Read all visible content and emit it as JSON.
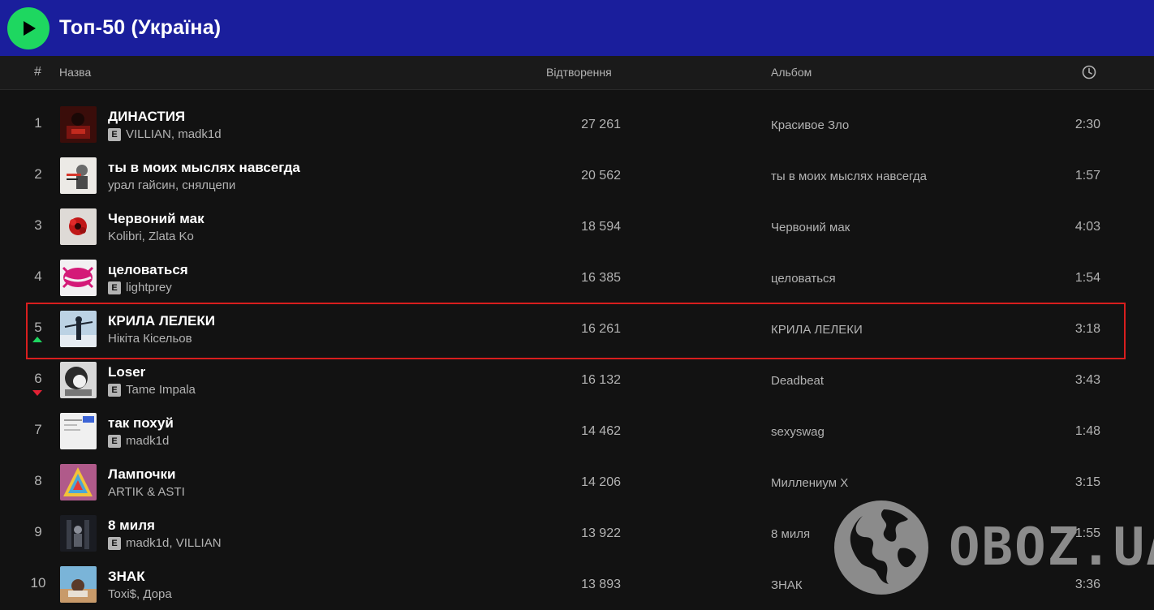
{
  "playlist": {
    "title": "Топ-50 (Україна)",
    "play_icon": "play-icon",
    "accent_color": "#1ed760",
    "header_color": "#1a1e9c"
  },
  "columns": {
    "number": "#",
    "title": "Назва",
    "plays": "Відтворення",
    "album": "Альбом",
    "duration_icon": "clock-icon"
  },
  "tracks": [
    {
      "rank": "1",
      "name": "ДИНАСТИЯ",
      "explicit": true,
      "artists": "VILLIAN, madk1d",
      "plays": "27 261",
      "album": "Красивое Зло",
      "duration": "2:30",
      "trend": ""
    },
    {
      "rank": "2",
      "name": "ты в моих мыслях навсегда",
      "explicit": false,
      "artists": "урал гайсин, снялцепи",
      "plays": "20 562",
      "album": "ты в моих мыслях навсегда",
      "duration": "1:57",
      "trend": ""
    },
    {
      "rank": "3",
      "name": "Червоний мак",
      "explicit": false,
      "artists": "Kolibri, Zlata Ko",
      "plays": "18 594",
      "album": "Червоний мак",
      "duration": "4:03",
      "trend": ""
    },
    {
      "rank": "4",
      "name": "целоваться",
      "explicit": true,
      "artists": "lightprey",
      "plays": "16 385",
      "album": "целоваться",
      "duration": "1:54",
      "trend": ""
    },
    {
      "rank": "5",
      "name": "КРИЛА ЛЕЛЕКИ",
      "explicit": false,
      "artists": "Нікіта Кісельов",
      "plays": "16 261",
      "album": "КРИЛА ЛЕЛЕКИ",
      "duration": "3:18",
      "trend": "up"
    },
    {
      "rank": "6",
      "name": "Loser",
      "explicit": true,
      "artists": "Tame Impala",
      "plays": "16 132",
      "album": "Deadbeat",
      "duration": "3:43",
      "trend": "down"
    },
    {
      "rank": "7",
      "name": "так похуй",
      "explicit": true,
      "artists": "madk1d",
      "plays": "14 462",
      "album": "sexyswag",
      "duration": "1:48",
      "trend": ""
    },
    {
      "rank": "8",
      "name": "Лампочки",
      "explicit": false,
      "artists": "ARTIK & ASTI",
      "plays": "14 206",
      "album": "Миллениум X",
      "duration": "3:15",
      "trend": ""
    },
    {
      "rank": "9",
      "name": "8 миля",
      "explicit": true,
      "artists": "madk1d, VILLIAN",
      "plays": "13 922",
      "album": "8 миля",
      "duration": "1:55",
      "trend": ""
    },
    {
      "rank": "10",
      "name": "ЗНАК",
      "explicit": false,
      "artists": "Toxi$, Дора",
      "plays": "13 893",
      "album": "ЗНАК",
      "duration": "3:36",
      "trend": ""
    }
  ],
  "explicit_label": "E",
  "watermark": {
    "text": "OBOZ.UA",
    "icon": "globe-icon"
  }
}
